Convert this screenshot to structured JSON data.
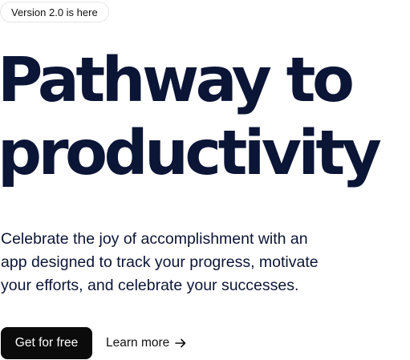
{
  "announcement": {
    "badge_text": "Version 2.0 is here"
  },
  "hero": {
    "headline_line1": "Pathway to",
    "headline_line2": "productivity",
    "subtitle_line1": "Celebrate the joy of accomplishment with an",
    "subtitle_line2": "app designed to track your progress, motivate",
    "subtitle_line3": "your efforts, and celebrate your successes."
  },
  "actions": {
    "primary_label": "Get for free",
    "secondary_label": "Learn more",
    "secondary_icon": "arrow-right-icon"
  },
  "colors": {
    "heading": "#0b1536",
    "primary_button_bg": "#0b0b0b",
    "primary_button_text": "#ffffff",
    "badge_border": "#e6e6ea"
  }
}
